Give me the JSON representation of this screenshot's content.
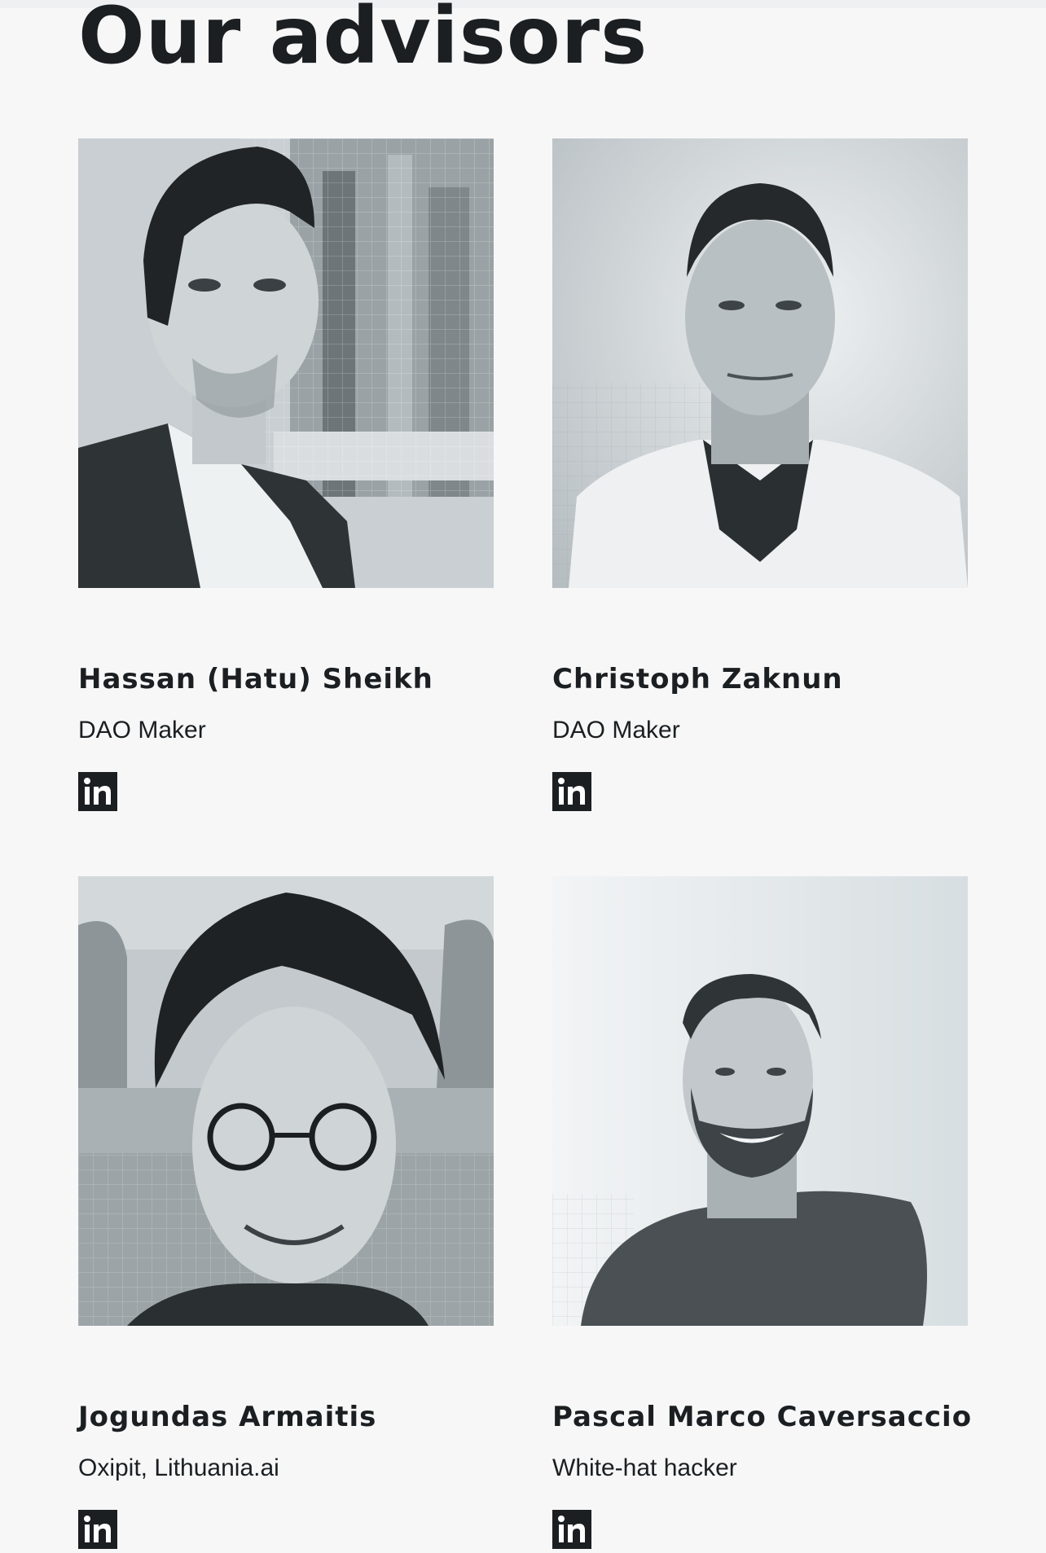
{
  "section": {
    "title": "Our advisors"
  },
  "advisors": [
    {
      "name": "Hassan (Hatu) Sheikh",
      "org": "DAO Maker",
      "photo": "portrait-photo",
      "link_icon": "linkedin-icon"
    },
    {
      "name": "Christoph Zaknun",
      "org": "DAO Maker",
      "photo": "portrait-photo",
      "link_icon": "linkedin-icon"
    },
    {
      "name": "Jogundas Armaitis",
      "org": "Oxipit, Lithuania.ai",
      "photo": "portrait-photo",
      "link_icon": "linkedin-icon"
    },
    {
      "name": "Pascal Marco Caversaccio",
      "org": "White-hat hacker",
      "photo": "portrait-photo",
      "link_icon": "linkedin-icon"
    }
  ],
  "colors": {
    "background": "#f7f7f7",
    "text": "#1b1f22",
    "icon_bg": "#1b1f22"
  }
}
